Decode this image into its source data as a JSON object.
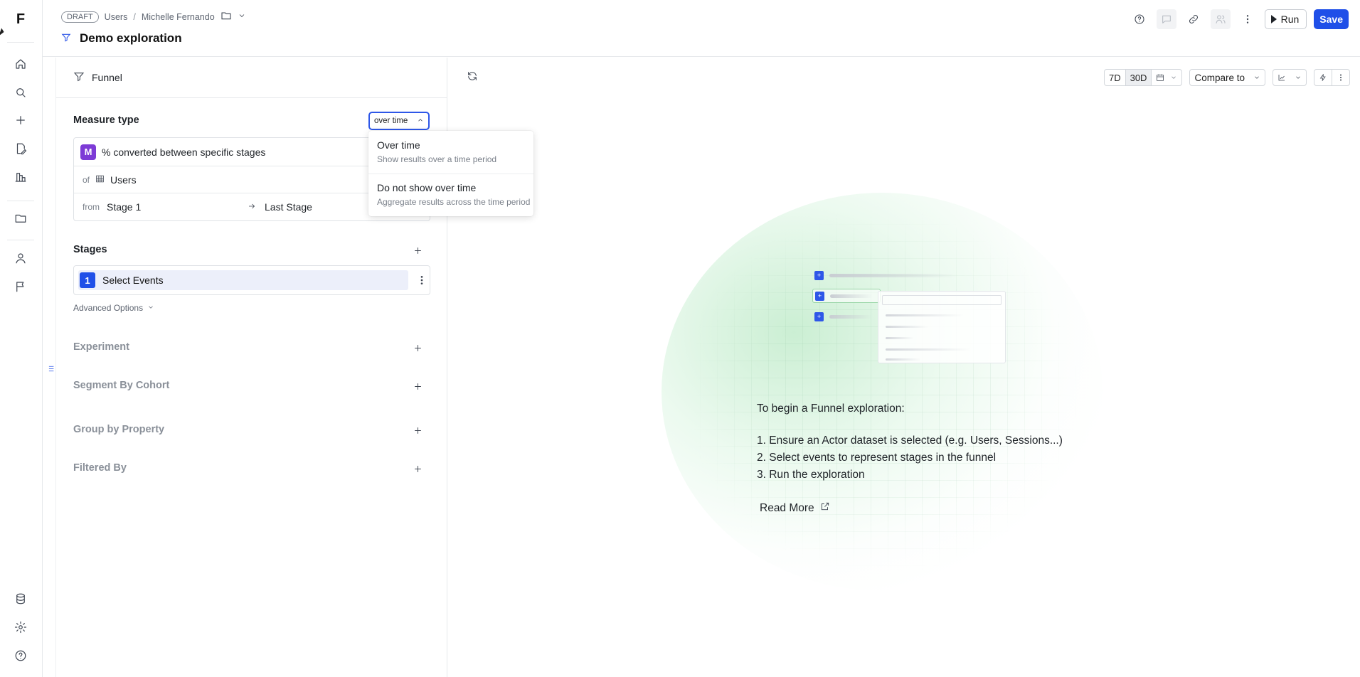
{
  "app": {
    "logo_letter": "F"
  },
  "breadcrumb": {
    "status": "DRAFT",
    "parent": "Users",
    "separator": "/",
    "owner": "Michelle Fernando"
  },
  "page": {
    "title": "Demo exploration"
  },
  "header": {
    "run_label": "Run",
    "save_label": "Save"
  },
  "panel": {
    "tab_label": "Funnel",
    "measure_type_label": "Measure type",
    "measure_dropdown_value": "over time",
    "measure_badge": "M",
    "measure_text": "% converted between specific stages",
    "of_label": "of",
    "dataset": "Users",
    "from_label": "from",
    "from_stage": "Stage 1",
    "to_stage": "Last Stage",
    "stages_label": "Stages",
    "stage_number": "1",
    "stage_text": "Select Events",
    "advanced_options": "Advanced Options",
    "experiment": "Experiment",
    "segment_by_cohort": "Segment By Cohort",
    "group_by_property": "Group by Property",
    "filtered_by": "Filtered By"
  },
  "dropdown": {
    "options": [
      {
        "title": "Over time",
        "subtitle": "Show results over a time period"
      },
      {
        "title": "Do not show over time",
        "subtitle": "Aggregate results across the time period"
      }
    ]
  },
  "toolbar": {
    "range_7d": "7D",
    "range_30d": "30D",
    "compare_label": "Compare to"
  },
  "empty_state": {
    "heading": "To begin a Funnel exploration:",
    "steps": [
      "1. Ensure an Actor dataset is selected (e.g. Users, Sessions...)",
      "2. Select events to represent stages in the funnel",
      "3. Run the exploration"
    ],
    "read_more": "Read More"
  },
  "colors": {
    "accent": "#1f4fe8",
    "measure_badge": "#7d3bd6",
    "stage_highlight": "#eceffa"
  }
}
